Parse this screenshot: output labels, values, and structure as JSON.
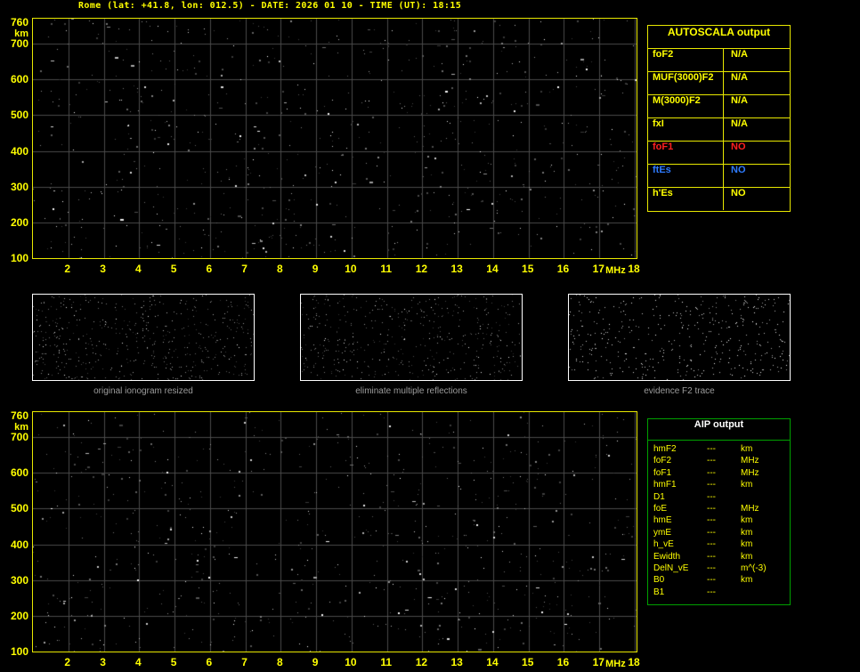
{
  "title": "Rome (lat: +41.8, lon: 012.5) - DATE: 2026 01 10 - TIME (UT): 18:15",
  "colors": {
    "title": "#ffff00",
    "yellow": "#ffff00",
    "red": "#ff2020",
    "blue": "#2e7bff",
    "plot_border": "#e8e800",
    "grid": "#4a4a4a",
    "autoscala_border": "#e8e800",
    "aip_border": "#00a000",
    "aip_header": "#ffffff",
    "thumb_border": "#ffffff",
    "thumb_label": "#9c9c9c"
  },
  "ionogram": {
    "x_unit": "MHz",
    "y_unit": "km",
    "x_ticks": [
      2,
      3,
      4,
      5,
      6,
      7,
      8,
      9,
      10,
      11,
      12,
      13,
      14,
      15,
      16,
      17,
      18
    ],
    "y_ticks": [
      760,
      700,
      600,
      500,
      400,
      300,
      200,
      100
    ],
    "x_range": [
      1.0,
      18.1
    ],
    "y_range": [
      95,
      770
    ]
  },
  "autoscala": {
    "header": "AUTOSCALA output",
    "rows": [
      {
        "param": "foF2",
        "value": "N/A",
        "color": "yellow"
      },
      {
        "param": "MUF(3000)F2",
        "value": "N/A",
        "color": "yellow"
      },
      {
        "param": "M(3000)F2",
        "value": "N/A",
        "color": "yellow"
      },
      {
        "param": "fxI",
        "value": "N/A",
        "color": "yellow"
      },
      {
        "param": "foF1",
        "value": "NO",
        "color": "red"
      },
      {
        "param": "ftEs",
        "value": "NO",
        "color": "blue"
      },
      {
        "param": "h'Es",
        "value": "NO",
        "color": "yellow"
      }
    ]
  },
  "thumbnails": [
    {
      "label": "original ionogram resized"
    },
    {
      "label": "eliminate multiple reflections"
    },
    {
      "label": "evidence F2 trace"
    }
  ],
  "aip": {
    "header": "AIP output",
    "rows": [
      {
        "param": "hmF2",
        "value": "---",
        "unit": "km"
      },
      {
        "param": "foF2",
        "value": "---",
        "unit": "MHz"
      },
      {
        "param": "foF1",
        "value": "---",
        "unit": "MHz"
      },
      {
        "param": "hmF1",
        "value": "---",
        "unit": "km"
      },
      {
        "param": "D1",
        "value": "---",
        "unit": ""
      },
      {
        "param": "foE",
        "value": "---",
        "unit": "MHz"
      },
      {
        "param": "hmE",
        "value": "---",
        "unit": "km"
      },
      {
        "param": "ymE",
        "value": "---",
        "unit": "km"
      },
      {
        "param": "h_vE",
        "value": "---",
        "unit": "km"
      },
      {
        "param": "Ewidth",
        "value": "---",
        "unit": "km"
      },
      {
        "param": "DelN_vE",
        "value": "---",
        "unit": "m^(-3)"
      },
      {
        "param": "B0",
        "value": "---",
        "unit": "km"
      },
      {
        "param": "B1",
        "value": "---",
        "unit": ""
      }
    ]
  }
}
